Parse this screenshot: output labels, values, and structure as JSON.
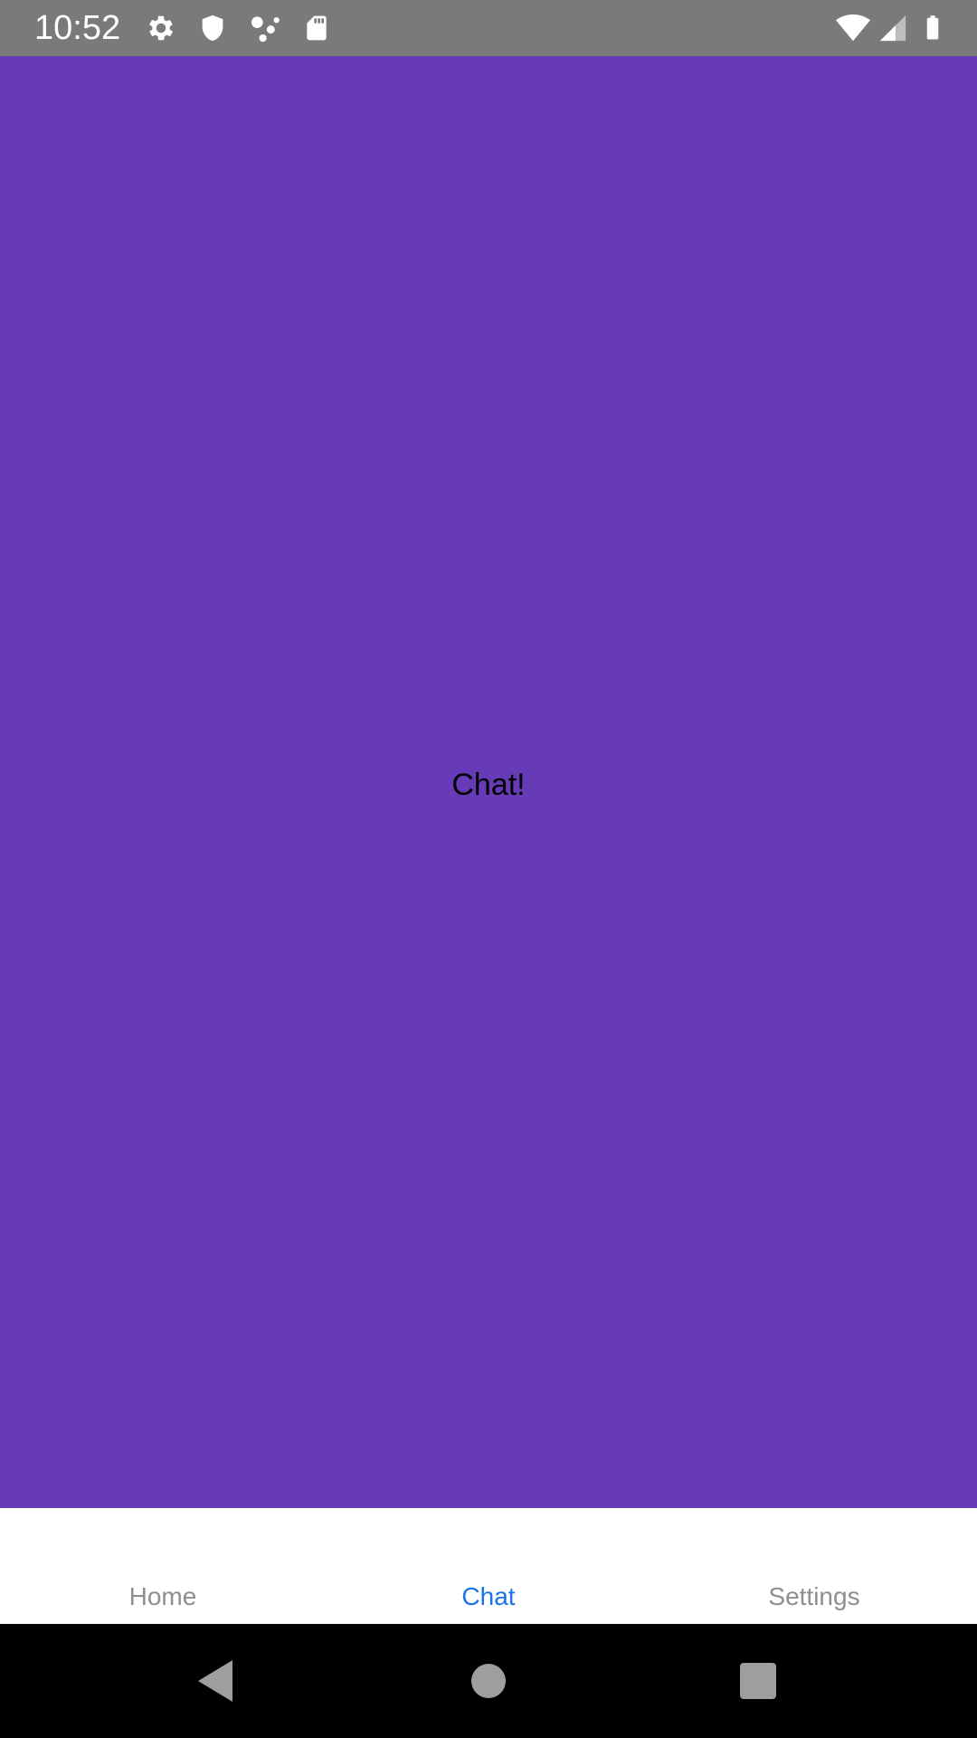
{
  "status_bar": {
    "time": "10:52",
    "icons_left": [
      "gear-icon",
      "shield-icon",
      "assistant-dots-icon",
      "sd-card-icon"
    ],
    "icons_right": [
      "wifi-icon",
      "signal-icon",
      "battery-icon"
    ],
    "background": "#7a7a7a"
  },
  "content": {
    "text": "Chat!",
    "background": "#673ab7"
  },
  "tabs": [
    {
      "label": "Home",
      "active": false
    },
    {
      "label": "Chat",
      "active": true
    },
    {
      "label": "Settings",
      "active": false
    }
  ],
  "colors": {
    "tab_active": "#1a73e8",
    "tab_inactive": "#8e8e93"
  },
  "nav_bar": {
    "buttons": [
      "back-icon",
      "home-icon",
      "recents-icon"
    ]
  }
}
